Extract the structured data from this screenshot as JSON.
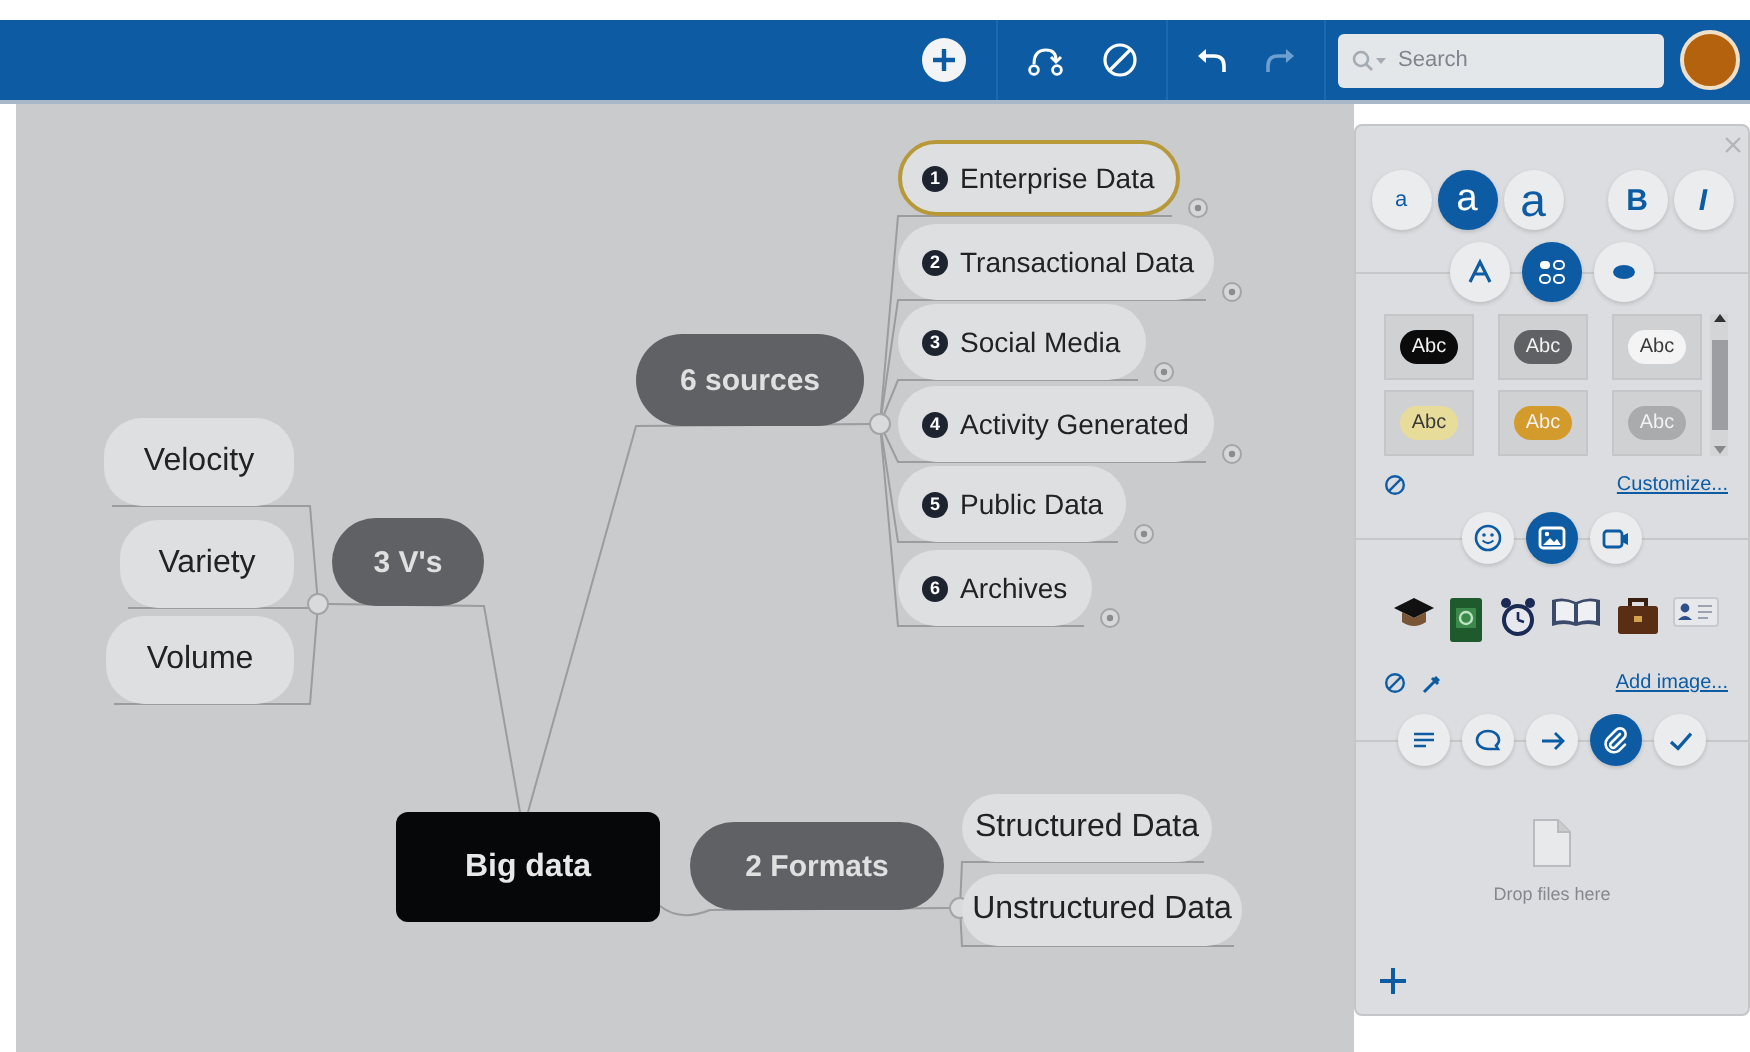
{
  "toolbar": {
    "search": {
      "placeholder": "Search"
    }
  },
  "mind_map": {
    "root": {
      "label": "Big data"
    },
    "branches": [
      {
        "label": "6 sources",
        "children": [
          {
            "number": "1",
            "label": "Enterprise Data",
            "selected": true
          },
          {
            "number": "2",
            "label": "Transactional Data",
            "selected": false
          },
          {
            "number": "3",
            "label": "Social Media",
            "selected": false
          },
          {
            "number": "4",
            "label": "Activity Generated",
            "selected": false
          },
          {
            "number": "5",
            "label": "Public Data",
            "selected": false
          },
          {
            "number": "6",
            "label": "Archives",
            "selected": false
          }
        ]
      },
      {
        "label": "3 V's",
        "children": [
          {
            "label": "Velocity",
            "selected": false
          },
          {
            "label": "Variety",
            "selected": false
          },
          {
            "label": "Volume",
            "selected": false
          }
        ]
      },
      {
        "label": "2 Formats",
        "children": [
          {
            "label": "Structured Data",
            "selected": false
          },
          {
            "label": "Unstructured Data",
            "selected": false
          }
        ]
      }
    ]
  },
  "panel": {
    "text_size_buttons": [
      {
        "label": "a",
        "selected": false
      },
      {
        "label": "a",
        "selected": true
      },
      {
        "label": "a",
        "selected": false
      }
    ],
    "text_style_buttons": [
      {
        "label": "B"
      },
      {
        "label": "I"
      }
    ],
    "shape_tabs": [
      {
        "selected": false
      },
      {
        "selected": true
      },
      {
        "selected": false
      }
    ],
    "style_presets": [
      {
        "label": "Abc",
        "color": "#0b0b0c"
      },
      {
        "label": "Abc",
        "color": "#5f6164"
      },
      {
        "label": "Abc",
        "color": "#f4f4f4"
      },
      {
        "label": "Abc",
        "color": "#e8dc9a"
      },
      {
        "label": "Abc",
        "color": "#d39a2c"
      },
      {
        "label": "Abc",
        "color": "#a9abad"
      }
    ],
    "customize_link": "Customize...",
    "media_tabs": [
      {
        "selected": false
      },
      {
        "selected": true
      },
      {
        "selected": false
      }
    ],
    "add_image_link": "Add image...",
    "attachment_tabs": [
      {
        "selected": false
      },
      {
        "selected": false
      },
      {
        "selected": false
      },
      {
        "selected": true
      },
      {
        "selected": false
      }
    ],
    "drop_hint": "Drop files here"
  }
}
